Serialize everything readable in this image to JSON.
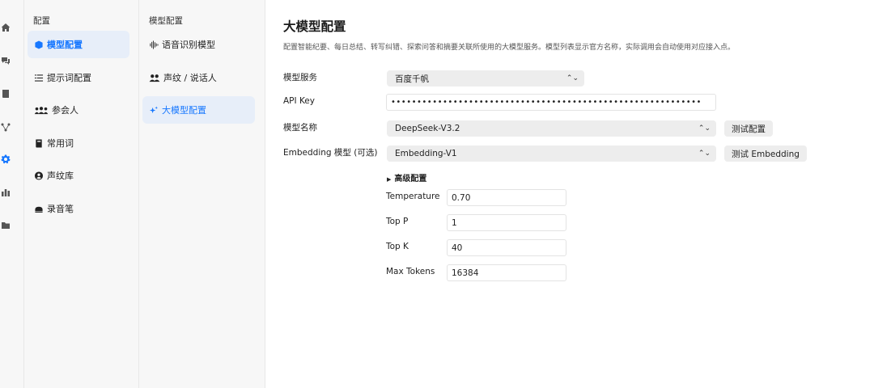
{
  "rail": {
    "icons": [
      "home-icon",
      "chat-icon",
      "book-icon",
      "graph-icon",
      "gear-icon",
      "chart-icon",
      "folder-icon"
    ],
    "active": "gear-icon",
    "accent": "#1677ff"
  },
  "col1": {
    "title": "配置",
    "items": [
      {
        "label": "模型配置",
        "icon": "cube-icon",
        "active": true
      },
      {
        "label": "提示词配置",
        "icon": "list-icon",
        "active": false
      },
      {
        "label": "参会人",
        "icon": "users-icon",
        "active": false
      },
      {
        "label": "常用词",
        "icon": "book-icon",
        "active": false
      },
      {
        "label": "声纹库",
        "icon": "user-circle-icon",
        "active": false
      },
      {
        "label": "录音笔",
        "icon": "recorder-icon",
        "active": false
      }
    ]
  },
  "col2": {
    "title": "模型配置",
    "items": [
      {
        "label": "语音识别模型",
        "icon": "waveform-icon",
        "active": false
      },
      {
        "label": "声纹 / 说话人",
        "icon": "people-icon",
        "active": false
      },
      {
        "label": "大模型配置",
        "icon": "sparkle-icon",
        "active": true
      }
    ]
  },
  "main": {
    "title": "大模型配置",
    "description": "配置智能纪要、每日总结、转写纠错、探索问答和摘要关联所使用的大模型服务。模型列表显示官方名称，实际调用会自动使用对应接入点。",
    "service_label": "模型服务",
    "service_value": "百度千帆",
    "apikey_label": "API Key",
    "apikey_value": "••••••••••••••••••••••••••••••••••••••••••••••••••••••••••••",
    "model_label": "模型名称",
    "model_value": "DeepSeek-V3.2",
    "test_config_button": "测试配置",
    "embedding_label": "Embedding 模型 (可选)",
    "embedding_value": "Embedding-V1",
    "test_embedding_button": "测试 Embedding",
    "advanced_label": "高级配置",
    "params": [
      {
        "label": "Temperature",
        "value": "0.70"
      },
      {
        "label": "Top P",
        "value": "1"
      },
      {
        "label": "Top K",
        "value": "40"
      },
      {
        "label": "Max Tokens",
        "value": "16384"
      }
    ]
  }
}
